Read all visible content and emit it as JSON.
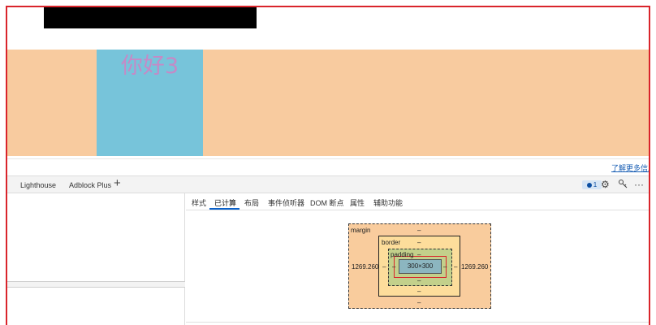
{
  "page": {
    "heading_text": "你好3",
    "learn_more_link": "了解更多信息"
  },
  "devtools": {
    "panel_tabs": [
      "Lighthouse",
      "Adblock Plus"
    ],
    "add_tab_symbol": "+",
    "issues_count": "1",
    "sub_tabs": [
      "样式",
      "已计算",
      "布局",
      "事件侦听器",
      "DOM 断点",
      "属性",
      "辅助功能"
    ],
    "active_sub_tab": "已计算",
    "box_model": {
      "margin_label": "margin",
      "margin_top": "–",
      "margin_bottom": "–",
      "margin_left": "1269.260",
      "margin_right": "1269.260",
      "border_label": "border",
      "border_top": "–",
      "border_bottom": "–",
      "border_left": "–",
      "border_right": "–",
      "padding_label": "padding",
      "padding_top": "–",
      "padding_bottom": "–",
      "padding_left": "–",
      "padding_right": "–",
      "content_size": "300×300"
    }
  },
  "colors": {
    "orange_band": "#f8cb9f",
    "blue_box": "#77c4da",
    "frame_red": "#d9242b",
    "accent_blue": "#0b61c9"
  }
}
